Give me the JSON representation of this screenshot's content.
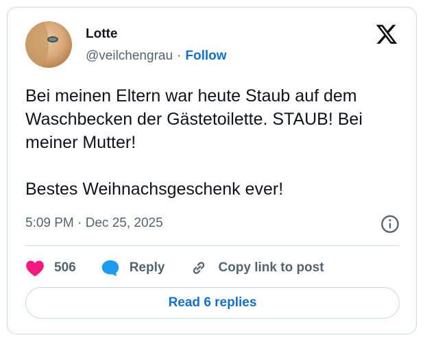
{
  "author": {
    "name": "Lotte",
    "handle": "@veilchengrau",
    "separator": "·",
    "follow_label": "Follow"
  },
  "tweet": {
    "text": "Bei meinen Eltern war heute Staub auf dem Waschbecken der Gästetoilette. STAUB! Bei meiner Mutter!\n\nBestes Weihnachsgeschenk ever!",
    "timestamp": "5:09 PM · Dec 25, 2025"
  },
  "actions": {
    "likes_count": "506",
    "reply_label": "Reply",
    "copy_link_label": "Copy link to post"
  },
  "footer": {
    "read_replies_label": "Read 6 replies"
  },
  "icons": {
    "brand": "x-logo-icon",
    "info": "info-icon",
    "like": "heart-icon",
    "reply": "speech-bubble-icon",
    "copy": "link-icon"
  },
  "colors": {
    "accent": "#0f71d1",
    "like": "#f91880",
    "reply_icon": "#1d9bf0",
    "muted": "#536471",
    "border": "#cfd9de"
  }
}
